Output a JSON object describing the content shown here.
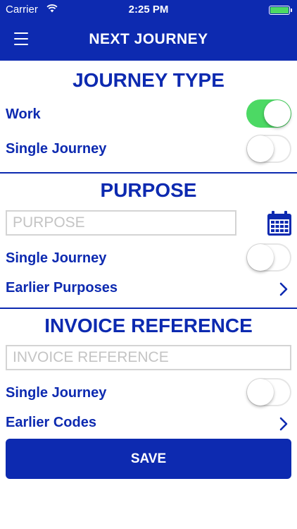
{
  "status_bar": {
    "carrier": "Carrier",
    "time": "2:25 PM"
  },
  "nav": {
    "title": "NEXT JOURNEY"
  },
  "journey_type": {
    "title": "JOURNEY TYPE",
    "work_label": "Work",
    "work_on": true,
    "single_label": "Single Journey",
    "single_on": false
  },
  "purpose": {
    "title": "PURPOSE",
    "placeholder": "PURPOSE",
    "single_label": "Single Journey",
    "single_on": false,
    "earlier_label": "Earlier Purposes"
  },
  "invoice": {
    "title": "INVOICE REFERENCE",
    "placeholder": "INVOICE REFERENCE",
    "single_label": "Single Journey",
    "single_on": false,
    "earlier_label": "Earlier Codes"
  },
  "save_label": "SAVE",
  "colors": {
    "primary": "#0d2ab0",
    "toggle_on": "#4cd964",
    "background": "#ffffff",
    "battery": "#4cd964"
  }
}
